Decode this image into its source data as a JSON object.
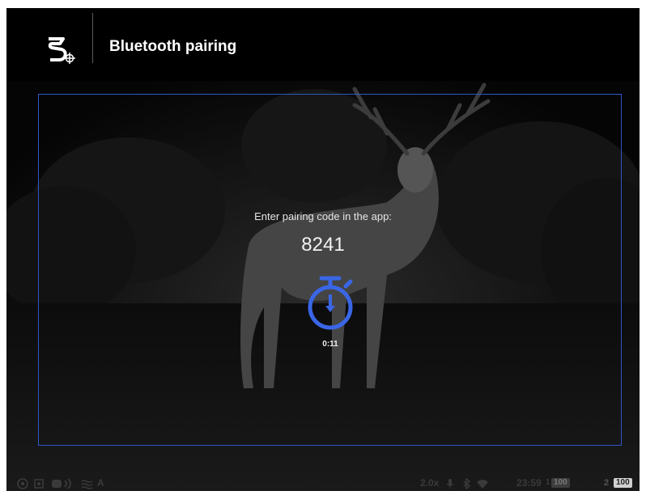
{
  "header": {
    "logo_icon": "brand-reticle-icon",
    "title": "Bluetooth pairing"
  },
  "pairing": {
    "prompt": "Enter pairing code in the app:",
    "code": "8241",
    "timer_icon": "stopwatch-icon",
    "countdown": "0:11",
    "accent_color": "#3a66e6"
  },
  "status_bar": {
    "left_icons": [
      "target-icon",
      "frame-icon",
      "signal-broadcast-icon",
      "wind-icon"
    ],
    "mode_label": "A",
    "zoom": "2.0x",
    "right_icons": [
      "microphone-icon",
      "bluetooth-icon",
      "wifi-icon"
    ],
    "time": "23:59",
    "battery_1_index": "1",
    "battery_1_level": "100",
    "battery_2_index": "2",
    "battery_2_level": "100"
  }
}
